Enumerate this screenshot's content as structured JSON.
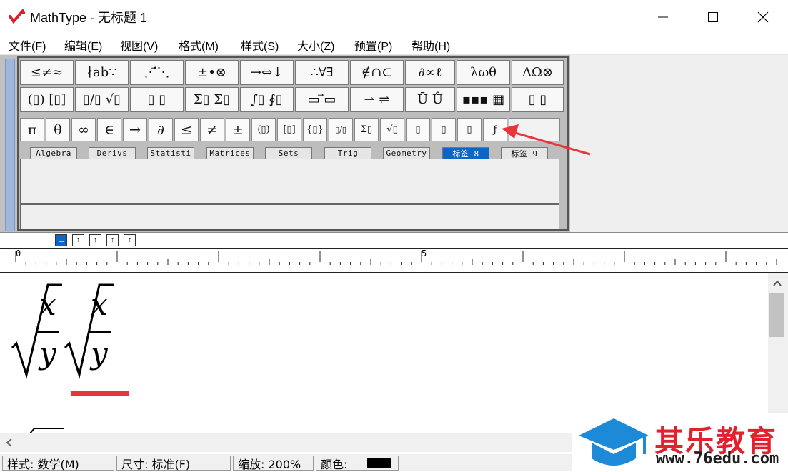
{
  "window": {
    "app_name": "MathType",
    "title": "MathType - 无标题 1",
    "buttons": {
      "minimize": "minimize",
      "maximize": "maximize",
      "close": "close"
    }
  },
  "menu": [
    "文件(F)",
    "编辑(E)",
    "视图(V)",
    "格式(M)",
    "样式(S)",
    "大小(Z)",
    "预置(P)",
    "帮助(H)"
  ],
  "palette_row1": [
    "≤≠≈",
    "∤ab∵",
    "⋰⃗⋱",
    "±•⊗",
    "→⇔↓",
    "∴∀∃",
    "∉∩⊂",
    "∂∞ℓ",
    "λωθ",
    "ΛΩ⊗"
  ],
  "palette_row2": [
    "(▯) [▯]",
    "▯/▯ √▯",
    "▯ ▯",
    "Σ▯ Σ▯",
    "∫▯ ∮▯",
    "▭ ⃗▭",
    "⇀ ⇌",
    "Ū Ů",
    "▪▪▪ ▦",
    "▯ ▯"
  ],
  "small_row": [
    "π",
    "θ",
    "∞",
    "∈",
    "→",
    "∂",
    "≤",
    "≠",
    "±",
    "(▯)",
    "[▯]",
    "{▯}",
    "▯/▯",
    "Σ▯",
    "√▯",
    "▯",
    "▯",
    "▯",
    "ƒ"
  ],
  "tabs": [
    {
      "label": "Algebra",
      "active": false
    },
    {
      "label": "Derivs",
      "active": false
    },
    {
      "label": "Statisti",
      "active": false
    },
    {
      "label": "Matrices",
      "active": false
    },
    {
      "label": "Sets",
      "active": false
    },
    {
      "label": "Trig",
      "active": false
    },
    {
      "label": "Geometry",
      "active": false
    },
    {
      "label": "标签 8",
      "active": true
    },
    {
      "label": "标签 9",
      "active": false
    }
  ],
  "ruler": {
    "marks": [
      "0",
      "5"
    ]
  },
  "editor": {
    "expr1": {
      "numerator": "x",
      "denominator": "y"
    },
    "expr2": {
      "numerator": "x",
      "denominator": "y"
    }
  },
  "status": {
    "style": "样式: 数学(M)",
    "size": "尺寸: 标准(F)",
    "zoom": "缩放: 200%",
    "color_label": "颜色:",
    "color_value": "#000000"
  },
  "watermark": {
    "name": "其乐教育",
    "url": "www.76edu.com"
  },
  "colors": {
    "accent": "#0a66c8",
    "annotation": "#e8353a",
    "watermark": "#e0222f",
    "logo_blue": "#1d8ad8"
  }
}
